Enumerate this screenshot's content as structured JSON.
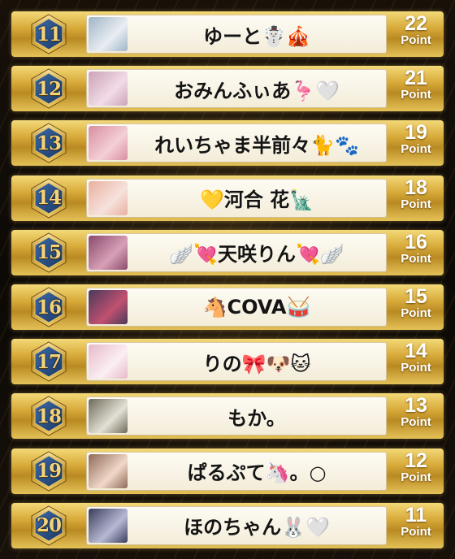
{
  "ranking": [
    {
      "rank": "11",
      "name": "ゆーと☃️🎪",
      "points": "22",
      "unit": "Point",
      "avatar_colors": [
        "#9fb4c6",
        "#e9eef2"
      ]
    },
    {
      "rank": "12",
      "name": "おみんふぃあ🦩🤍",
      "points": "21",
      "unit": "Point",
      "avatar_colors": [
        "#c9a3b8",
        "#f2dbe6"
      ]
    },
    {
      "rank": "13",
      "name": "れいちゃま半前々🐈🐾",
      "points": "19",
      "unit": "Point",
      "avatar_colors": [
        "#d78fa0",
        "#f4cfd6"
      ]
    },
    {
      "rank": "14",
      "name": "💛河合 花🗽",
      "points": "18",
      "unit": "Point",
      "avatar_colors": [
        "#e8b0a0",
        "#f6e2dc"
      ]
    },
    {
      "rank": "15",
      "name": "🪽💘天咲りん💘🪽",
      "points": "16",
      "unit": "Point",
      "avatar_colors": [
        "#8a4a6a",
        "#d7a0b8"
      ]
    },
    {
      "rank": "16",
      "name": "🐴COVA🥁",
      "points": "15",
      "unit": "Point",
      "avatar_colors": [
        "#4a3a5a",
        "#c05070"
      ]
    },
    {
      "rank": "17",
      "name": "りの🎀🐶🐱",
      "points": "14",
      "unit": "Point",
      "avatar_colors": [
        "#e6b9c9",
        "#fbeff3"
      ]
    },
    {
      "rank": "18",
      "name": "もか。",
      "points": "13",
      "unit": "Point",
      "avatar_colors": [
        "#6e6a5a",
        "#e3e0d6"
      ]
    },
    {
      "rank": "19",
      "name": "ぱるぷて🦄。○",
      "points": "12",
      "unit": "Point",
      "avatar_colors": [
        "#8e6a58",
        "#f1d8c8"
      ]
    },
    {
      "rank": "20",
      "name": "ほのちゃん🐰🤍",
      "points": "11",
      "unit": "Point",
      "avatar_colors": [
        "#3a3d5a",
        "#b7b9d4"
      ]
    }
  ]
}
